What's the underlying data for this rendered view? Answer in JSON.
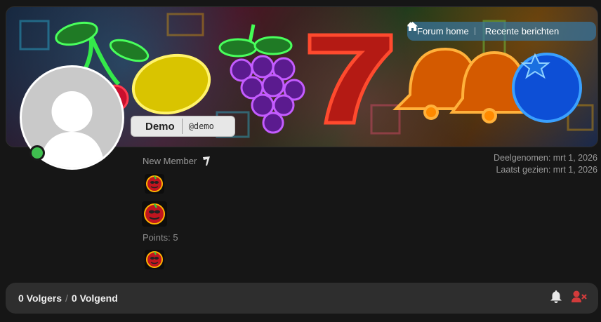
{
  "nav": {
    "forum_home": "Forum home",
    "recent_posts": "Recente berichten"
  },
  "profile": {
    "display_name": "Demo",
    "handle": "@demo",
    "rank": "New Member",
    "points": "Points: 5",
    "joined": "Deelgenomen: mrt 1, 2026",
    "last_seen": "Laatst gezien: mrt 1, 2026",
    "online": true
  },
  "follow": {
    "followers": "0 Volgers",
    "separator": "/",
    "following": "0 Volgend"
  },
  "colors": {
    "online": "#3fbf4f",
    "nav_pill": "#3876a0",
    "unfollow_icon": "#d23b3b"
  },
  "icons": [
    "home-icon",
    "reply-icon",
    "rank-icon",
    "cherry-badge-icon",
    "bell-icon",
    "user-remove-icon"
  ]
}
